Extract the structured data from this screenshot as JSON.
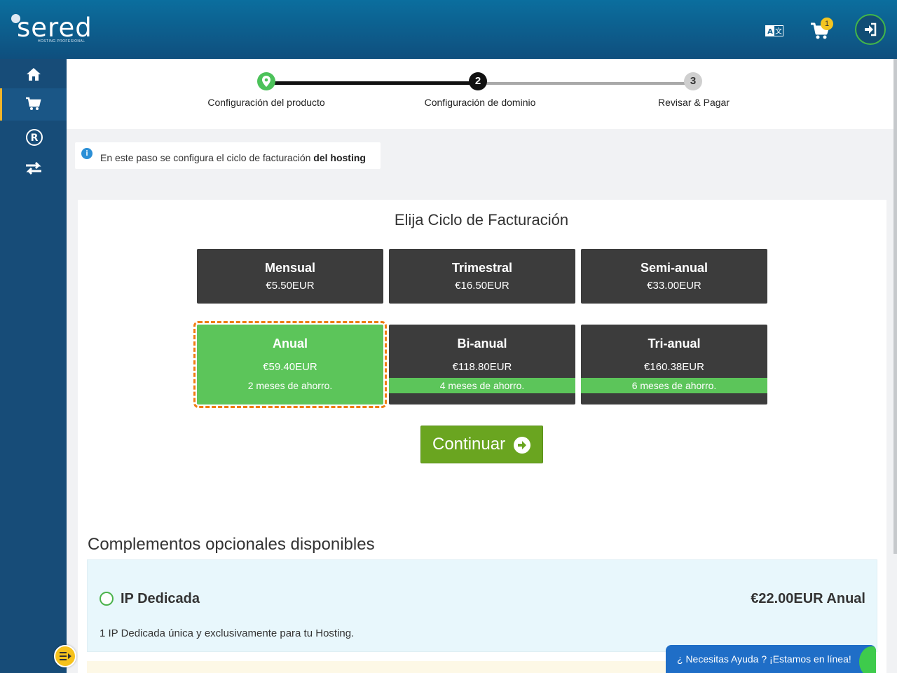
{
  "brand": {
    "name": "sered",
    "tagline": "HOSTING PROFESIONAL"
  },
  "header": {
    "cart_count": "1",
    "icons": [
      "translate-icon",
      "cart-icon",
      "login-icon"
    ]
  },
  "sidebar": {
    "items": [
      {
        "icon": "home-icon"
      },
      {
        "icon": "cart-icon",
        "active": true
      },
      {
        "icon": "registered-icon"
      },
      {
        "icon": "transfer-icon"
      }
    ]
  },
  "stepper": {
    "steps": [
      {
        "number": "",
        "label": "Configuración del producto",
        "state": "done"
      },
      {
        "number": "2",
        "label": "Configuración de dominio",
        "state": "current"
      },
      {
        "number": "3",
        "label": "Revisar & Pagar",
        "state": "pending"
      }
    ]
  },
  "info": {
    "text": "En este paso se configura el ciclo de facturación ",
    "bold": "del hosting"
  },
  "billing": {
    "title": "Elija Ciclo de Facturación",
    "cycles": [
      {
        "name": "Mensual",
        "price": "€5.50EUR",
        "saving": ""
      },
      {
        "name": "Trimestral",
        "price": "€16.50EUR",
        "saving": ""
      },
      {
        "name": "Semi-anual",
        "price": "€33.00EUR",
        "saving": ""
      },
      {
        "name": "Anual",
        "price": "€59.40EUR",
        "saving": "2 meses de ahorro.",
        "selected": true
      },
      {
        "name": "Bi-anual",
        "price": "€118.80EUR",
        "saving": "4 meses de ahorro."
      },
      {
        "name": "Tri-anual",
        "price": "€160.38EUR",
        "saving": "6 meses de ahorro."
      }
    ],
    "continue_label": "Continuar"
  },
  "addons": {
    "title": "Complementos opcionales disponibles",
    "items": [
      {
        "name": "IP Dedicada",
        "price": "€22.00EUR Anual",
        "description": "1 IP Dedicada única y exclusivamente para tu Hosting.",
        "checked": false
      }
    ]
  },
  "chat": {
    "text": "¿ Necesitas Ayuda ? ¡Estamos en línea!"
  },
  "colors": {
    "header": "#0d5d8c",
    "sidebar": "#174c78",
    "selected": "#5cc55a",
    "cycle": "#3c3c3c",
    "continue": "#6aa520",
    "highlight": "#ef7d12"
  }
}
